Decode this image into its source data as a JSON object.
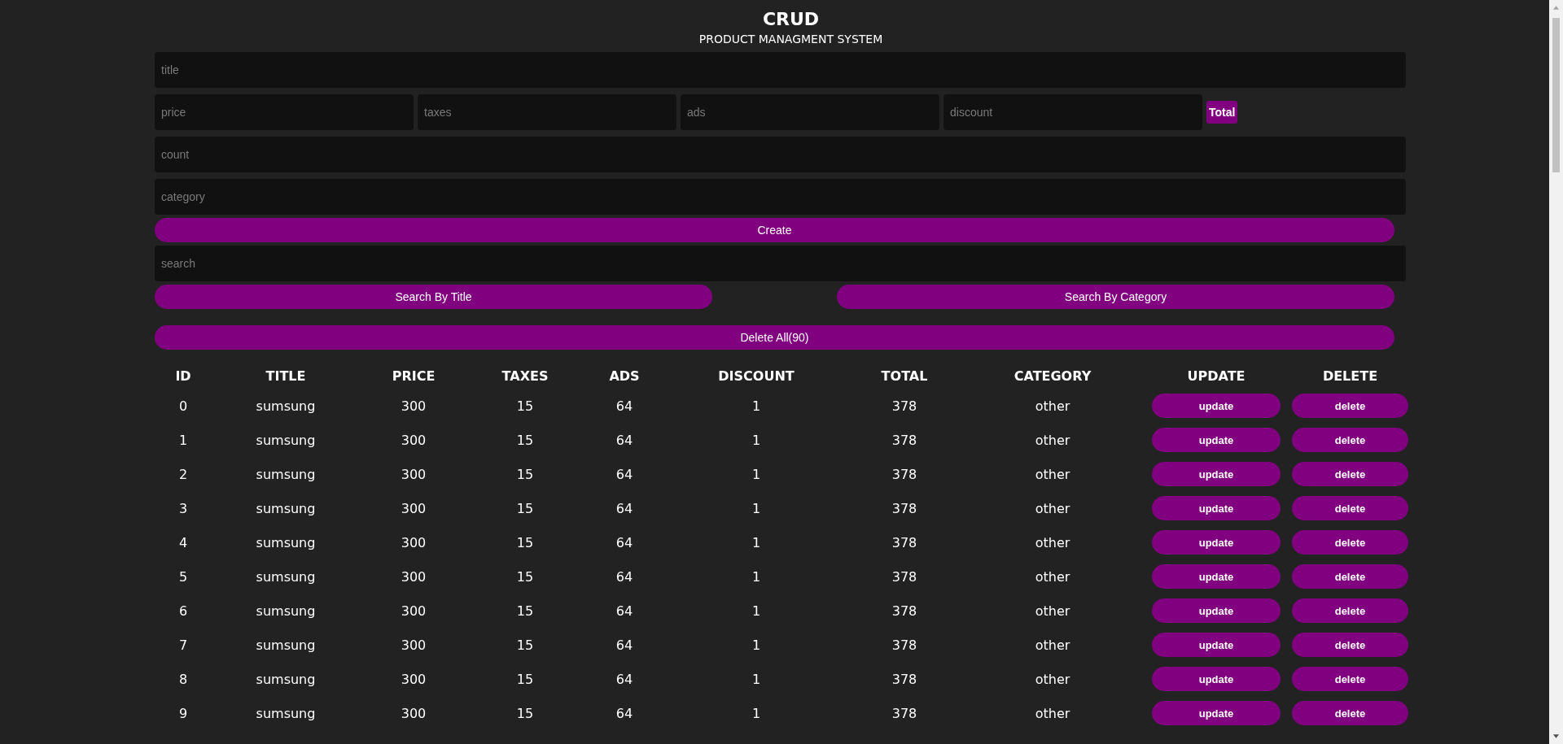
{
  "header": {
    "title": "CRUD",
    "subtitle": "PRODUCT MANAGMENT SYSTEM"
  },
  "form": {
    "title": {
      "placeholder": "title"
    },
    "price_row": [
      {
        "placeholder": "price"
      },
      {
        "placeholder": "taxes"
      },
      {
        "placeholder": "ads"
      },
      {
        "placeholder": "discount"
      }
    ],
    "total_label": "Total",
    "count": {
      "placeholder": "count"
    },
    "category": {
      "placeholder": "category"
    },
    "create_button": "Create"
  },
  "search": {
    "placeholder": "search",
    "buttons": [
      "Search By Title",
      "Search By Category"
    ]
  },
  "delete_all_button": "Delete All(90)",
  "table": {
    "columns": [
      "ID",
      "TITLE",
      "PRICE",
      "TAXES",
      "ADS",
      "DISCOUNT",
      "TOTAL",
      "CATEGORY",
      "UPDATE",
      "DELETE"
    ],
    "rows": [
      {
        "cells": [
          "0",
          "sumsung",
          "300",
          "15",
          "64",
          "1",
          "378",
          "other"
        ],
        "update": "update",
        "delete": "delete"
      },
      {
        "cells": [
          "1",
          "sumsung",
          "300",
          "15",
          "64",
          "1",
          "378",
          "other"
        ],
        "update": "update",
        "delete": "delete"
      },
      {
        "cells": [
          "2",
          "sumsung",
          "300",
          "15",
          "64",
          "1",
          "378",
          "other"
        ],
        "update": "update",
        "delete": "delete"
      },
      {
        "cells": [
          "3",
          "sumsung",
          "300",
          "15",
          "64",
          "1",
          "378",
          "other"
        ],
        "update": "update",
        "delete": "delete"
      },
      {
        "cells": [
          "4",
          "sumsung",
          "300",
          "15",
          "64",
          "1",
          "378",
          "other"
        ],
        "update": "update",
        "delete": "delete"
      },
      {
        "cells": [
          "5",
          "sumsung",
          "300",
          "15",
          "64",
          "1",
          "378",
          "other"
        ],
        "update": "update",
        "delete": "delete"
      },
      {
        "cells": [
          "6",
          "sumsung",
          "300",
          "15",
          "64",
          "1",
          "378",
          "other"
        ],
        "update": "update",
        "delete": "delete"
      },
      {
        "cells": [
          "7",
          "sumsung",
          "300",
          "15",
          "64",
          "1",
          "378",
          "other"
        ],
        "update": "update",
        "delete": "delete"
      },
      {
        "cells": [
          "8",
          "sumsung",
          "300",
          "15",
          "64",
          "1",
          "378",
          "other"
        ],
        "update": "update",
        "delete": "delete"
      },
      {
        "cells": [
          "9",
          "sumsung",
          "300",
          "15",
          "64",
          "1",
          "378",
          "other"
        ],
        "update": "update",
        "delete": "delete"
      }
    ]
  }
}
